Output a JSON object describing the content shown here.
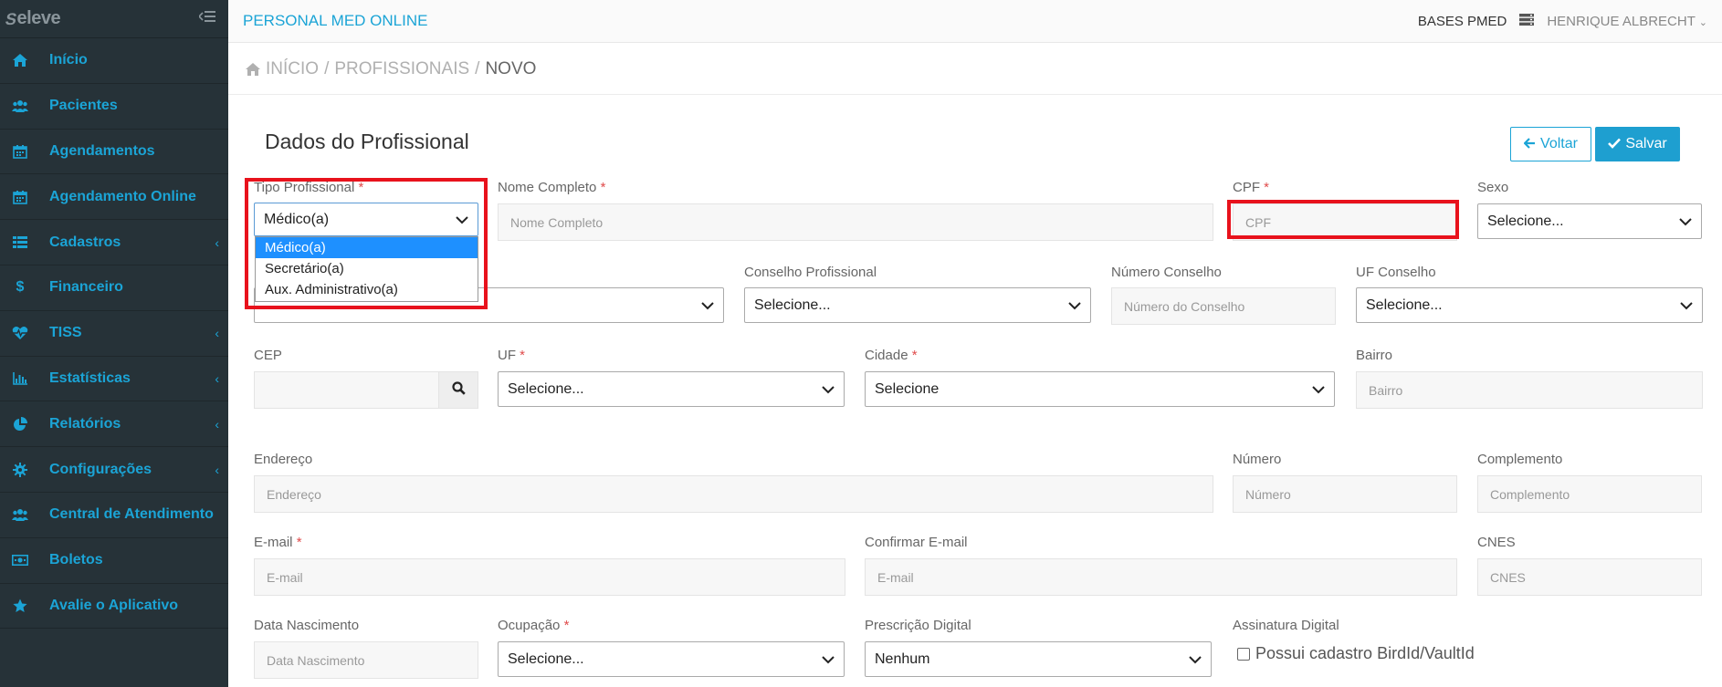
{
  "topbar": {
    "app_title": "PERSONAL MED ONLINE",
    "bases_label": "BASES PMED",
    "user_name": "HENRIQUE ALBRECHT"
  },
  "brand": {
    "logo_text": "eleve"
  },
  "sidebar": {
    "items": [
      {
        "label": "Início",
        "icon": "home-icon"
      },
      {
        "label": "Pacientes",
        "icon": "users-icon"
      },
      {
        "label": "Agendamentos",
        "icon": "calendar-icon"
      },
      {
        "label": "Agendamento Online",
        "icon": "calendar-icon"
      },
      {
        "label": "Cadastros",
        "icon": "list-icon"
      },
      {
        "label": "Financeiro",
        "icon": "dollar-icon"
      },
      {
        "label": "TISS",
        "icon": "heartbeat-icon"
      },
      {
        "label": "Estatísticas",
        "icon": "bar-chart-icon"
      },
      {
        "label": "Relatórios",
        "icon": "pie-chart-icon"
      },
      {
        "label": "Configurações",
        "icon": "gear-icon"
      },
      {
        "label": "Central de Atendimento",
        "icon": "users-icon"
      },
      {
        "label": "Boletos",
        "icon": "money-icon"
      },
      {
        "label": "Avalie o Aplicativo",
        "icon": "star-icon"
      }
    ]
  },
  "breadcrumb": {
    "home": "INÍCIO",
    "section": "PROFISSIONAIS",
    "current": "NOVO"
  },
  "form": {
    "title": "Dados do Profissional",
    "back_label": "Voltar",
    "save_label": "Salvar",
    "tipo_label": "Tipo Profissional",
    "tipo_value": "Médico(a)",
    "tipo_options": [
      "Médico(a)",
      "Secretário(a)",
      "Aux. Administrativo(a)"
    ],
    "nome_label": "Nome Completo",
    "nome_placeholder": "Nome Completo",
    "cpf_label": "CPF",
    "cpf_placeholder": "CPF",
    "sexo_label": "Sexo",
    "sexo_value": "Selecione...",
    "conselho_label": "Conselho Profissional",
    "conselho_value": "Selecione...",
    "numero_conselho_label": "Número Conselho",
    "numero_conselho_placeholder": "Número do Conselho",
    "uf_conselho_label": "UF Conselho",
    "uf_conselho_value": "Selecione...",
    "cep_label": "CEP",
    "uf_label": "UF",
    "uf_value": "Selecione...",
    "cidade_label": "Cidade",
    "cidade_value": "Selecione",
    "bairro_label": "Bairro",
    "bairro_placeholder": "Bairro",
    "endereco_label": "Endereço",
    "endereco_placeholder": "Endereço",
    "numero_label": "Número",
    "numero_placeholder": "Número",
    "complemento_label": "Complemento",
    "complemento_placeholder": "Complemento",
    "email_label": "E-mail",
    "email_placeholder": "E-mail",
    "confirmar_email_label": "Confirmar E-mail",
    "confirmar_email_placeholder": "E-mail",
    "cnes_label": "CNES",
    "cnes_placeholder": "CNES",
    "data_nasc_label": "Data Nascimento",
    "data_nasc_placeholder": "Data Nascimento",
    "ocupacao_label": "Ocupação",
    "ocupacao_value": "Selecione...",
    "prescricao_label": "Prescrição Digital",
    "prescricao_value": "Nenhum",
    "assinatura_label": "Assinatura Digital",
    "assinatura_checkbox": "Possui cadastro BirdId/VaultId",
    "required_mark": "*"
  },
  "colors": {
    "sidebar_bg": "#263238",
    "accent": "#1ba4d6",
    "highlight": "#e8121c"
  }
}
